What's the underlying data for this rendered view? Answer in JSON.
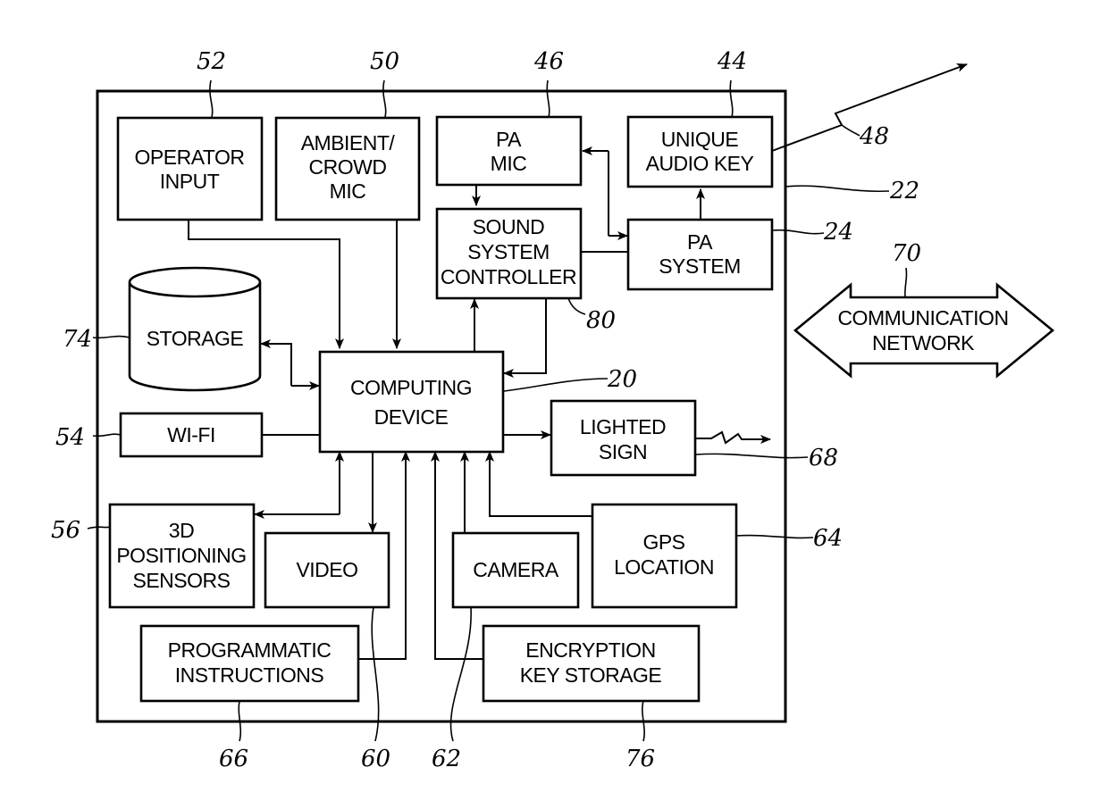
{
  "figure": {
    "system_ref": "22",
    "blocks": {
      "operator_input": {
        "lines": [
          "OPERATOR",
          "INPUT"
        ],
        "ref": "52"
      },
      "ambient_mic": {
        "lines": [
          "AMBIENT/",
          "CROWD",
          "MIC"
        ],
        "ref": "50"
      },
      "pa_mic": {
        "lines": [
          "PA",
          "MIC"
        ],
        "ref": "46"
      },
      "unique_audio_key": {
        "lines": [
          "UNIQUE",
          "AUDIO KEY"
        ],
        "ref": "44"
      },
      "sound_controller": {
        "lines": [
          "SOUND",
          "SYSTEM",
          "CONTROLLER"
        ],
        "ref": "80"
      },
      "pa_system": {
        "lines": [
          "PA",
          "SYSTEM"
        ],
        "ref": "24"
      },
      "storage": {
        "lines": [
          "STORAGE"
        ],
        "ref": "74"
      },
      "computing_device": {
        "lines": [
          "COMPUTING",
          "DEVICE"
        ],
        "ref": "20"
      },
      "wifi": {
        "lines": [
          "WI-FI"
        ],
        "ref": "54"
      },
      "lighted_sign": {
        "lines": [
          "LIGHTED",
          "SIGN"
        ],
        "ref": "68"
      },
      "positioning_sensors": {
        "lines": [
          "3D",
          "POSITIONING",
          "SENSORS"
        ],
        "ref": "56"
      },
      "video": {
        "lines": [
          "VIDEO"
        ],
        "ref": "60"
      },
      "camera": {
        "lines": [
          "CAMERA"
        ],
        "ref": "62"
      },
      "gps_location": {
        "lines": [
          "GPS",
          "LOCATION"
        ],
        "ref": "64"
      },
      "programmatic_instructions": {
        "lines": [
          "PROGRAMMATIC",
          "INSTRUCTIONS"
        ],
        "ref": "66"
      },
      "encryption_key_storage": {
        "lines": [
          "ENCRYPTION",
          "KEY STORAGE"
        ],
        "ref": "76"
      },
      "communication_network": {
        "lines": [
          "COMMUNICATION",
          "NETWORK"
        ],
        "ref": "70"
      }
    },
    "wireless_signal_ref": "48"
  }
}
